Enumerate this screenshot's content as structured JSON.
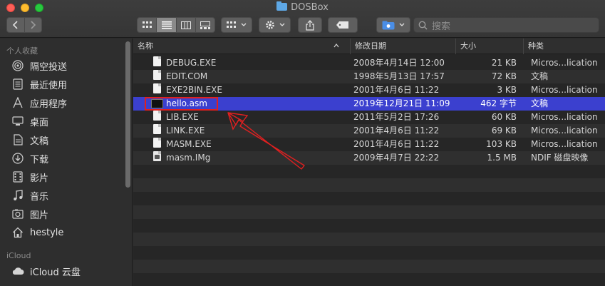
{
  "window": {
    "title": "DOSBox"
  },
  "toolbar": {
    "back_icon": "chevron-left-icon",
    "forward_icon": "chevron-right-icon",
    "view_modes": [
      "icon-view",
      "list-view",
      "column-view",
      "gallery-view"
    ],
    "active_view": "list-view",
    "group_icon": "grid-icon",
    "action_icon": "gear-icon",
    "share_icon": "share-icon",
    "tag_icon": "tag-icon",
    "cloud_icon": "cloud-drive-icon",
    "search_placeholder": "搜索"
  },
  "sidebar": {
    "favorites_title": "个人收藏",
    "favorites": [
      {
        "label": "隔空投送",
        "icon": "airdrop-icon"
      },
      {
        "label": "最近使用",
        "icon": "recents-icon"
      },
      {
        "label": "应用程序",
        "icon": "applications-icon"
      },
      {
        "label": "桌面",
        "icon": "desktop-icon"
      },
      {
        "label": "文稿",
        "icon": "documents-icon"
      },
      {
        "label": "下载",
        "icon": "downloads-icon"
      },
      {
        "label": "影片",
        "icon": "movies-icon"
      },
      {
        "label": "音乐",
        "icon": "music-icon"
      },
      {
        "label": "图片",
        "icon": "pictures-icon"
      },
      {
        "label": "hestyle",
        "icon": "home-icon"
      }
    ],
    "icloud_title": "iCloud",
    "icloud": [
      {
        "label": "iCloud 云盘",
        "icon": "cloud-icon"
      }
    ]
  },
  "columns": {
    "name": "名称",
    "date": "修改日期",
    "size": "大小",
    "kind": "种类"
  },
  "files": [
    {
      "name": "DEBUG.EXE",
      "date": "2008年4月14日 12:00",
      "size": "21 KB",
      "kind": "Micros...lication",
      "icon": "document-icon"
    },
    {
      "name": "EDIT.COM",
      "date": "1998年5月13日 17:57",
      "size": "72 KB",
      "kind": "文稿",
      "icon": "document-icon"
    },
    {
      "name": "EXE2BIN.EXE",
      "date": "2001年4月6日 11:22",
      "size": "3 KB",
      "kind": "Micros...lication",
      "icon": "document-icon"
    },
    {
      "name": "hello.asm",
      "date": "2019年12月21日 11:09",
      "size": "462 字节",
      "kind": "文稿",
      "icon": "terminal-icon",
      "selected": true
    },
    {
      "name": "LIB.EXE",
      "date": "2011年5月2日 17:26",
      "size": "60 KB",
      "kind": "Micros...lication",
      "icon": "document-icon"
    },
    {
      "name": "LINK.EXE",
      "date": "2001年4月6日 11:22",
      "size": "69 KB",
      "kind": "Micros...lication",
      "icon": "document-icon"
    },
    {
      "name": "MASM.EXE",
      "date": "2001年4月6日 11:22",
      "size": "103 KB",
      "kind": "Micros...lication",
      "icon": "document-icon"
    },
    {
      "name": "masm.IMg",
      "date": "2009年4月7日 22:22",
      "size": "1.5 MB",
      "kind": "NDIF 磁盘映像",
      "icon": "disk-image-icon"
    }
  ],
  "colors": {
    "selection": "#3b40cf",
    "annotation": "#e02020"
  }
}
